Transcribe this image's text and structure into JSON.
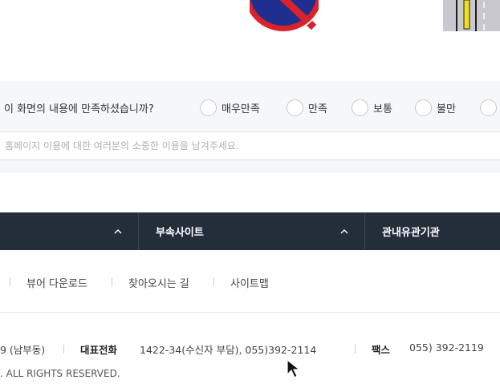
{
  "survey": {
    "question": "이 화면의 내용에 만족하셨습니까?",
    "options": [
      "매우만족",
      "만족",
      "보통",
      "불만",
      ""
    ],
    "comment_placeholder": "홈페이지 이용에 대한 여러분의 소중한 이용을 남겨주세요."
  },
  "nav": {
    "items": [
      "부속사이트",
      "관내유관기관"
    ]
  },
  "links": {
    "items": [
      "뷰어 다운로드",
      "찾아오시는 길",
      "사이트맵"
    ]
  },
  "footer": {
    "address_tail": "9 (남부동)",
    "phone_label": "대표전화",
    "phone_value": "1422-34(수신자 부담), 055)392-2114",
    "fax_label": "팩스",
    "fax_value": "055) 392-2119",
    "copyright": ". ALL RIGHTS RESERVED."
  },
  "colors": {
    "navbar": "#242e3b",
    "survey_bg": "#f6f7f9"
  }
}
